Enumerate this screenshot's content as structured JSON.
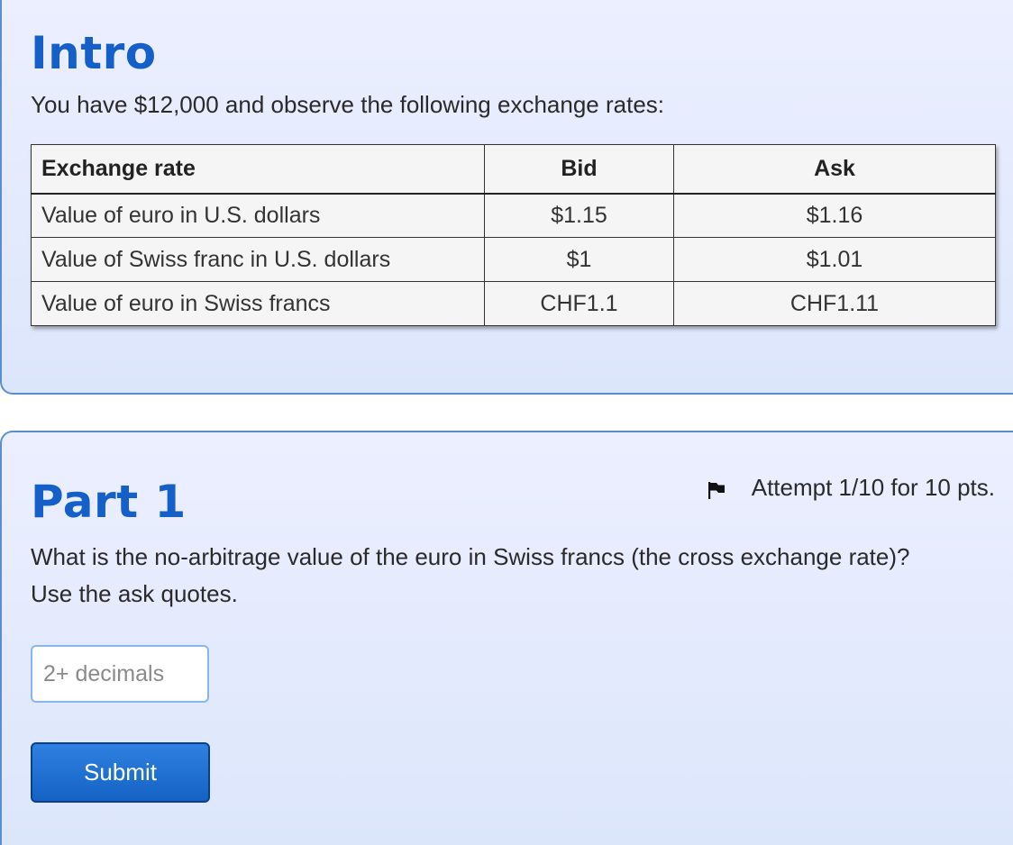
{
  "intro": {
    "title": "Intro",
    "text": "You have $12,000 and observe the following exchange rates:",
    "table": {
      "headers": [
        "Exchange rate",
        "Bid",
        "Ask"
      ],
      "rows": [
        [
          "Value of euro in U.S. dollars",
          "$1.15",
          "$1.16"
        ],
        [
          "Value of Swiss franc in U.S. dollars",
          "$1",
          "$1.01"
        ],
        [
          "Value of euro in Swiss francs",
          "CHF1.1",
          "CHF1.11"
        ]
      ]
    }
  },
  "part1": {
    "title": "Part 1",
    "attempt": "Attempt 1/10 for 10 pts.",
    "question_line1": "What is the no-arbitrage value of the euro in Swiss francs (the cross exchange rate)?",
    "question_line2": "Use the ask quotes.",
    "input": {
      "value": "",
      "placeholder": "2+ decimals"
    },
    "submit_label": "Submit"
  },
  "colors": {
    "heading": "#1460c8",
    "card_border": "#5b8ed0",
    "button": "#1463c4"
  },
  "icons": {
    "attempt": "flag-icon"
  }
}
